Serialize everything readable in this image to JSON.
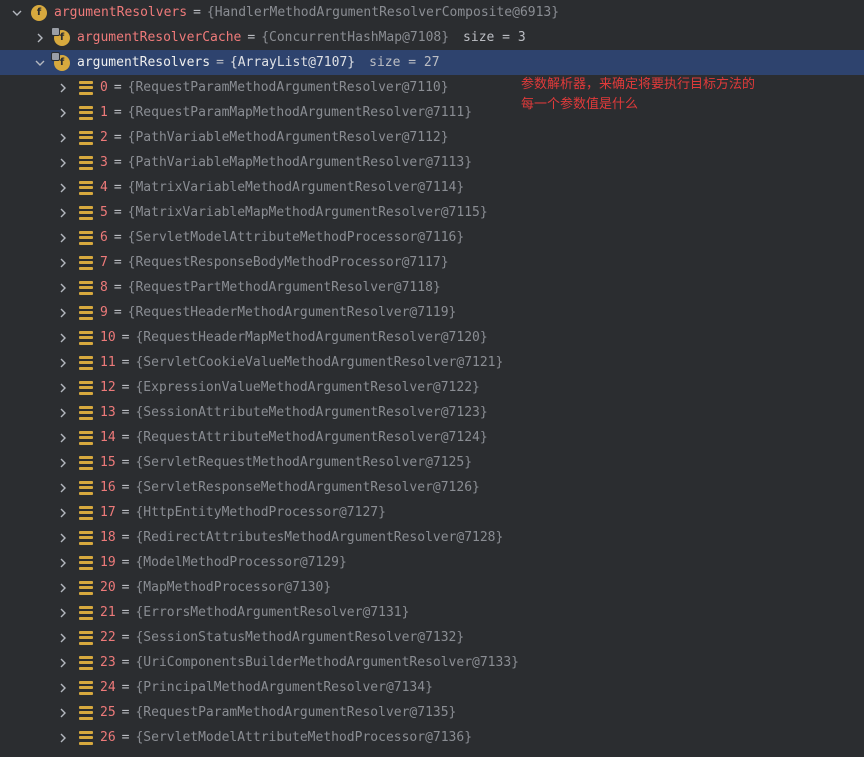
{
  "root": {
    "name": "argumentResolvers",
    "value": "{HandlerMethodArgumentResolverComposite@6913}"
  },
  "cache": {
    "name": "argumentResolverCache",
    "value": "{ConcurrentHashMap@7108}",
    "size": "size = 3"
  },
  "list": {
    "name": "argumentResolvers",
    "value": "{ArrayList@7107}",
    "size": "size = 27"
  },
  "annotation": {
    "line1": "参数解析器，来确定将要执行目标方法的",
    "line2": "每一个参数值是什么"
  },
  "items": [
    {
      "idx": "0",
      "value": "{RequestParamMethodArgumentResolver@7110}"
    },
    {
      "idx": "1",
      "value": "{RequestParamMapMethodArgumentResolver@7111}"
    },
    {
      "idx": "2",
      "value": "{PathVariableMethodArgumentResolver@7112}"
    },
    {
      "idx": "3",
      "value": "{PathVariableMapMethodArgumentResolver@7113}"
    },
    {
      "idx": "4",
      "value": "{MatrixVariableMethodArgumentResolver@7114}"
    },
    {
      "idx": "5",
      "value": "{MatrixVariableMapMethodArgumentResolver@7115}"
    },
    {
      "idx": "6",
      "value": "{ServletModelAttributeMethodProcessor@7116}"
    },
    {
      "idx": "7",
      "value": "{RequestResponseBodyMethodProcessor@7117}"
    },
    {
      "idx": "8",
      "value": "{RequestPartMethodArgumentResolver@7118}"
    },
    {
      "idx": "9",
      "value": "{RequestHeaderMethodArgumentResolver@7119}"
    },
    {
      "idx": "10",
      "value": "{RequestHeaderMapMethodArgumentResolver@7120}"
    },
    {
      "idx": "11",
      "value": "{ServletCookieValueMethodArgumentResolver@7121}"
    },
    {
      "idx": "12",
      "value": "{ExpressionValueMethodArgumentResolver@7122}"
    },
    {
      "idx": "13",
      "value": "{SessionAttributeMethodArgumentResolver@7123}"
    },
    {
      "idx": "14",
      "value": "{RequestAttributeMethodArgumentResolver@7124}"
    },
    {
      "idx": "15",
      "value": "{ServletRequestMethodArgumentResolver@7125}"
    },
    {
      "idx": "16",
      "value": "{ServletResponseMethodArgumentResolver@7126}"
    },
    {
      "idx": "17",
      "value": "{HttpEntityMethodProcessor@7127}"
    },
    {
      "idx": "18",
      "value": "{RedirectAttributesMethodArgumentResolver@7128}"
    },
    {
      "idx": "19",
      "value": "{ModelMethodProcessor@7129}"
    },
    {
      "idx": "20",
      "value": "{MapMethodProcessor@7130}"
    },
    {
      "idx": "21",
      "value": "{ErrorsMethodArgumentResolver@7131}"
    },
    {
      "idx": "22",
      "value": "{SessionStatusMethodArgumentResolver@7132}"
    },
    {
      "idx": "23",
      "value": "{UriComponentsBuilderMethodArgumentResolver@7133}"
    },
    {
      "idx": "24",
      "value": "{PrincipalMethodArgumentResolver@7134}"
    },
    {
      "idx": "25",
      "value": "{RequestParamMethodArgumentResolver@7135}"
    },
    {
      "idx": "26",
      "value": "{ServletModelAttributeMethodProcessor@7136}"
    }
  ]
}
